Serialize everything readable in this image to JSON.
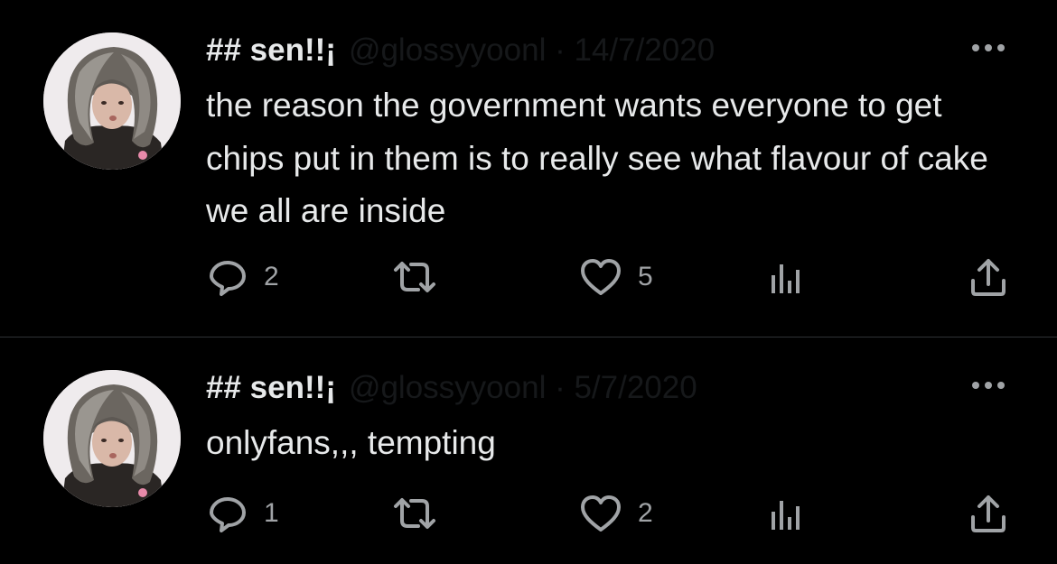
{
  "tweets": [
    {
      "display_name": "## sen!!¡",
      "handle_meta": "@glossyyoonl · 14/7/2020",
      "text": "the reason the government wants everyone to get chips put in them is to really see what flavour of cake we all are inside",
      "replies": "2",
      "retweets": "",
      "likes": "5"
    },
    {
      "display_name": "## sen!!¡",
      "handle_meta": "@glossyyoonl · 5/7/2020",
      "text": "onlyfans,,, tempting",
      "replies": "1",
      "retweets": "",
      "likes": "2"
    }
  ],
  "icons": {
    "more": "more-icon",
    "reply": "reply-icon",
    "retweet": "retweet-icon",
    "like": "heart-icon",
    "views": "views-icon",
    "share": "share-icon"
  },
  "colors": {
    "background": "#000000",
    "text": "#e7e9ea",
    "icon": "#a0a3a6",
    "divider": "#2f3336"
  }
}
